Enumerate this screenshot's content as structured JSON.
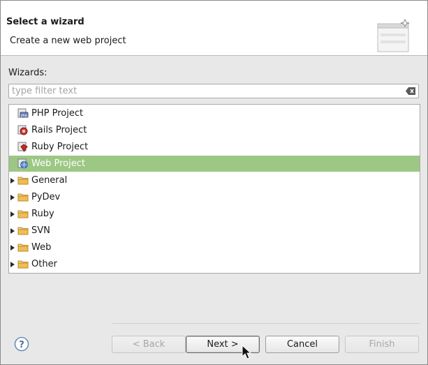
{
  "header": {
    "title": "Select a wizard",
    "subtitle": "Create a new web project"
  },
  "wizards_label": "Wizards:",
  "filter": {
    "placeholder": "type filter text",
    "value": ""
  },
  "tree": {
    "items": [
      {
        "label": "PHP Project",
        "icon": "php-project-icon",
        "expandable": false,
        "selected": false
      },
      {
        "label": "Rails Project",
        "icon": "rails-project-icon",
        "expandable": false,
        "selected": false
      },
      {
        "label": "Ruby Project",
        "icon": "ruby-project-icon",
        "expandable": false,
        "selected": false
      },
      {
        "label": "Web Project",
        "icon": "web-project-icon",
        "expandable": false,
        "selected": true
      },
      {
        "label": "General",
        "icon": "folder-icon",
        "expandable": true,
        "selected": false
      },
      {
        "label": "PyDev",
        "icon": "folder-icon",
        "expandable": true,
        "selected": false
      },
      {
        "label": "Ruby",
        "icon": "folder-icon",
        "expandable": true,
        "selected": false
      },
      {
        "label": "SVN",
        "icon": "folder-icon",
        "expandable": true,
        "selected": false
      },
      {
        "label": "Web",
        "icon": "folder-icon",
        "expandable": true,
        "selected": false
      },
      {
        "label": "Other",
        "icon": "folder-icon",
        "expandable": true,
        "selected": false
      }
    ]
  },
  "buttons": {
    "back": "< Back",
    "next": "Next >",
    "cancel": "Cancel",
    "finish": "Finish"
  },
  "colors": {
    "selection": "#9cc784",
    "folder": "#e8b04a"
  }
}
